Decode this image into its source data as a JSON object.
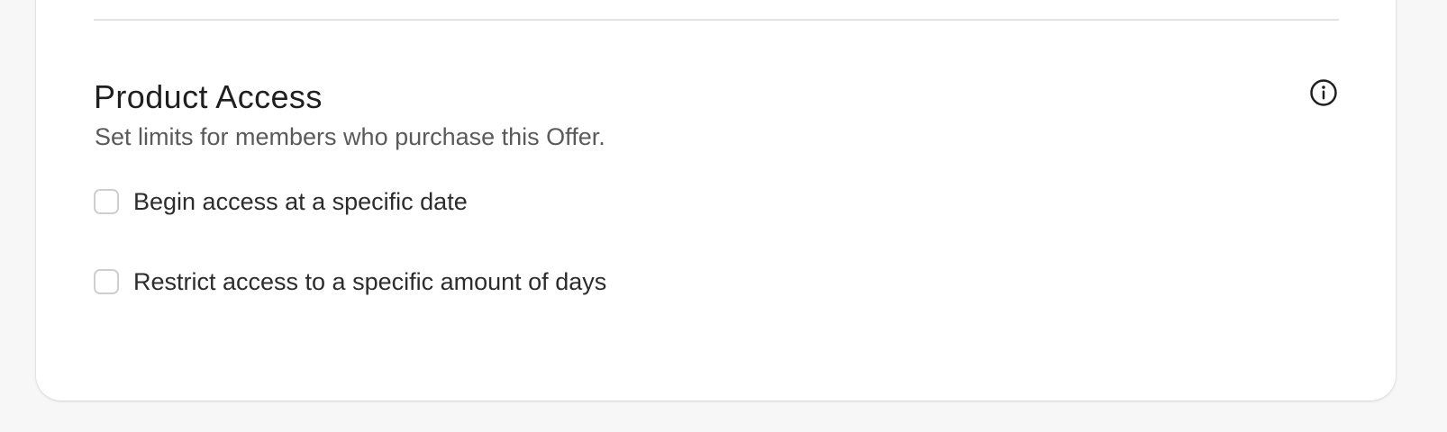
{
  "section": {
    "title": "Product Access",
    "description": "Set limits for members who purchase this Offer.",
    "info_icon": "info-circle-icon"
  },
  "options": [
    {
      "label": "Begin access at a specific date",
      "checked": false
    },
    {
      "label": "Restrict access to a specific amount of days",
      "checked": false
    }
  ],
  "colors": {
    "page_background": "#f7f7f7",
    "card_background": "#ffffff",
    "title_text": "#1f1f1f",
    "description_text": "#5a5a5a",
    "checkbox_border": "#cfcfcf",
    "divider": "#e2e2e2"
  }
}
